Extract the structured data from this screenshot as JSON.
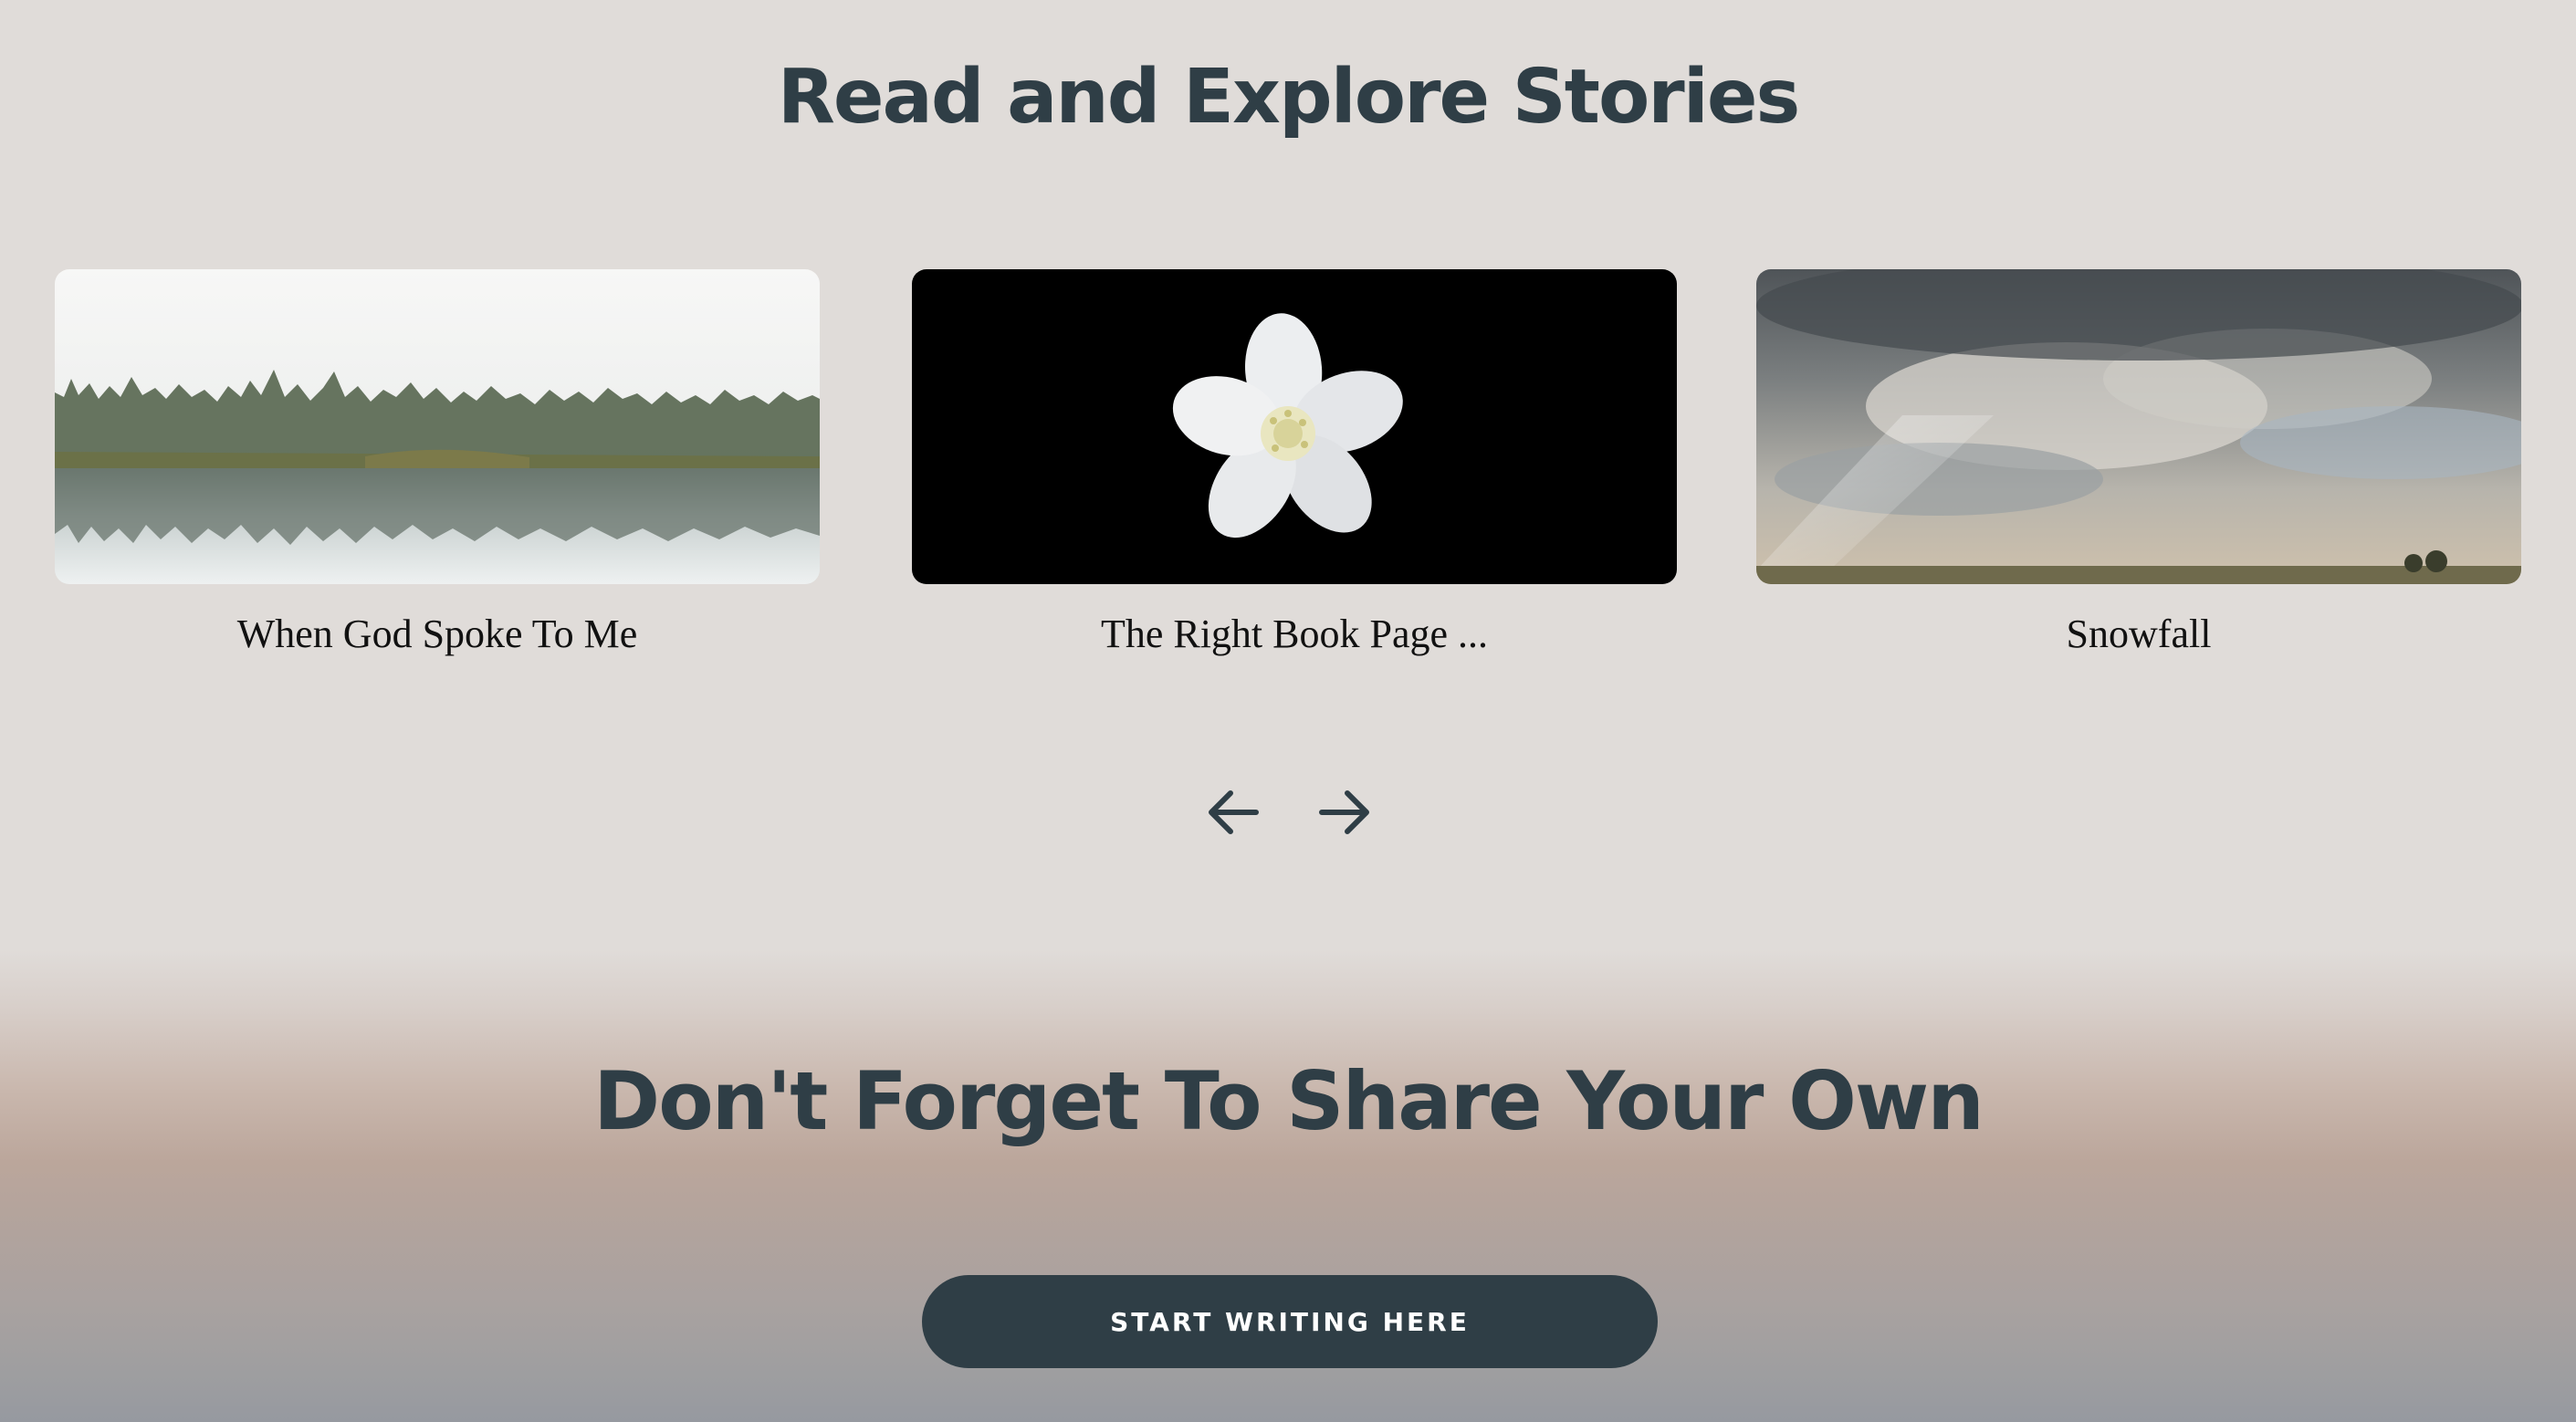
{
  "stories": {
    "heading": "Read and Explore Stories",
    "cards": [
      {
        "title": "When God Spoke To Me",
        "image": "misty-lake-forest-reflection"
      },
      {
        "title": "The Right Book Page ...",
        "image": "white-flower-on-black"
      },
      {
        "title": "Snowfall",
        "image": "cloudy-sky-over-prairie"
      }
    ],
    "nav": {
      "prev_icon": "arrow-left-icon",
      "next_icon": "arrow-right-icon"
    }
  },
  "share": {
    "heading": "Don't Forget To Share Your Own",
    "button_label": "START WRITING HERE"
  },
  "colors": {
    "background": "#e0dcd9",
    "heading": "#2f3e46",
    "button": "#2f3e46",
    "button_text": "#ffffff"
  }
}
